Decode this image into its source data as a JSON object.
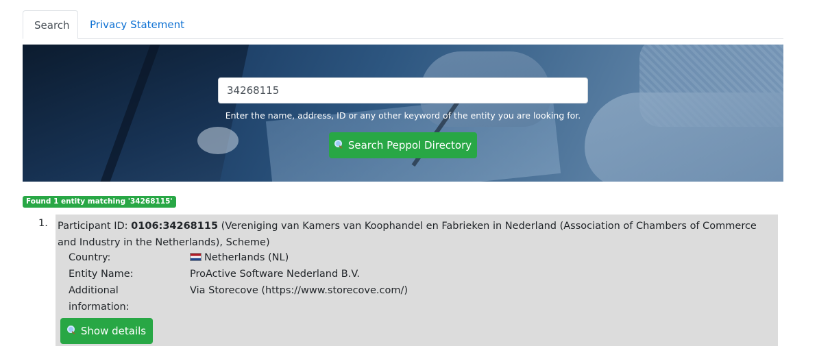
{
  "tabs": [
    {
      "label": "Search",
      "active": true
    },
    {
      "label": "Privacy Statement",
      "active": false
    }
  ],
  "search": {
    "value": "34268115",
    "hint": "Enter the name, address, ID or any other keyword of the entity you are looking for.",
    "button_label": "Search Peppol Directory",
    "button_icon": "magnifier-icon"
  },
  "results": {
    "badge": "Found 1 entity matching '34268115'",
    "items": [
      {
        "number": "1.",
        "participant_label": "Participant ID:",
        "participant_id": "0106:34268115",
        "scheme_text": "(Vereniging van Kamers van Koophandel en Fabrieken in Nederland (Association of Chambers of Commerce and Industry in the Netherlands), Scheme)",
        "country_label": "Country:",
        "country_value": "Netherlands (NL)",
        "country_flag": "nl-flag-icon",
        "entity_label": "Entity Name:",
        "entity_value": "ProActive Software Nederland B.V.",
        "additional_label_1": "Additional",
        "additional_label_2": "information:",
        "additional_value": "Via Storecove (https://www.storecove.com/)",
        "details_button": "Show details"
      }
    ]
  },
  "colors": {
    "accent_green": "#28a745",
    "link_blue": "#0b6fd2",
    "result_bg": "#dcdcdc"
  }
}
